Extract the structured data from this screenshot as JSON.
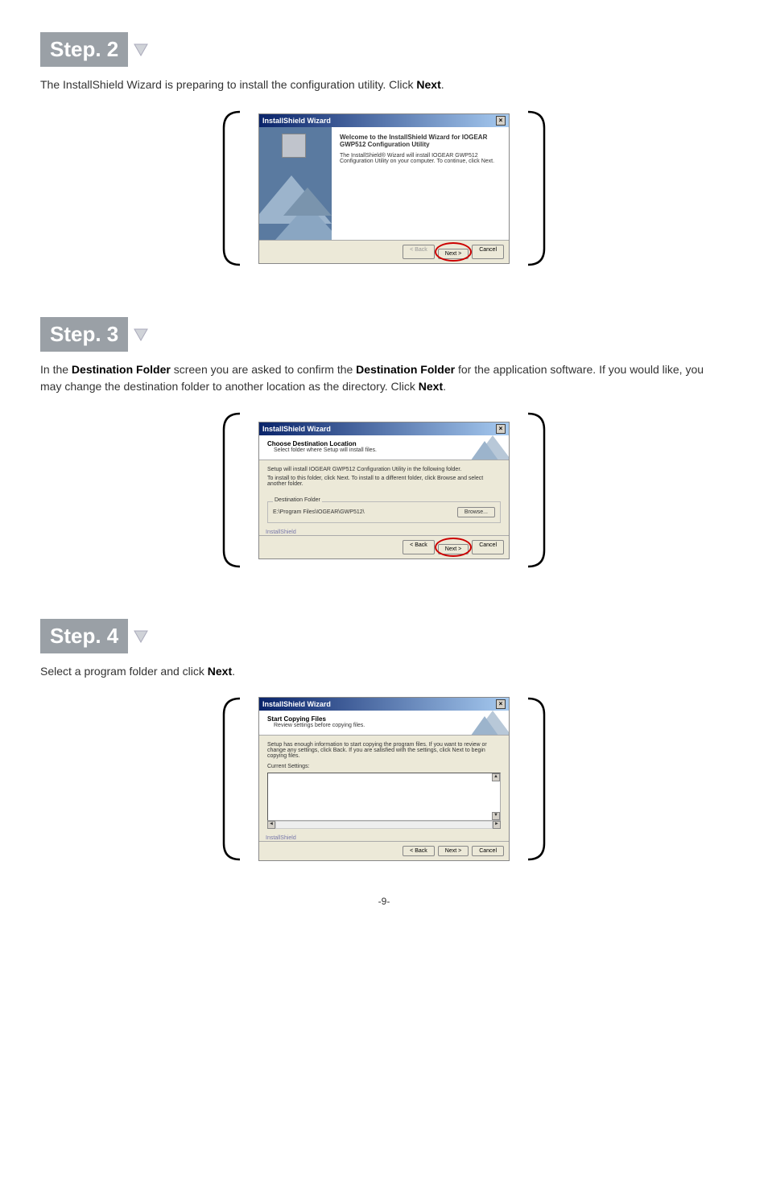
{
  "page_number": "-9-",
  "steps": {
    "s2": {
      "badge": "Step. 2",
      "desc_pre": "The InstallShield Wizard is preparing to install the configuration utility. Click ",
      "desc_bold": "Next",
      "desc_post": "."
    },
    "s3": {
      "badge": "Step. 3",
      "desc_p1": "In the ",
      "desc_b1": "Destination Folder",
      "desc_p2": " screen you are asked to confirm the ",
      "desc_b2": "Destination Folder",
      "desc_p3": " for the application software. If you would like, you may change the destination folder to another location as the directory. Click ",
      "desc_b3": "Next",
      "desc_p4": "."
    },
    "s4": {
      "badge": "Step. 4",
      "desc_pre": "Select a program folder and click ",
      "desc_bold": "Next",
      "desc_post": "."
    }
  },
  "dialog1": {
    "title": "InstallShield Wizard",
    "heading": "Welcome to the InstallShield Wizard for IOGEAR GWP512 Configuration Utility",
    "body": "The InstallShield® Wizard will install IOGEAR GWP512 Configuration Utility on your computer. To continue, click Next.",
    "btn_back": "< Back",
    "btn_next": "Next >",
    "btn_cancel": "Cancel"
  },
  "dialog2": {
    "title": "InstallShield Wizard",
    "heading": "Choose Destination Location",
    "sub": "Select folder where Setup will install files.",
    "line1": "Setup will install IOGEAR GWP512 Configuration Utility in the following folder.",
    "line2": "To install to this folder, click Next. To install to a different folder, click Browse and select another folder.",
    "group_label": "Destination Folder",
    "path": "E:\\Program Files\\IOGEAR\\GWP512\\",
    "btn_browse": "Browse...",
    "install_shield": "InstallShield",
    "btn_back": "< Back",
    "btn_next": "Next >",
    "btn_cancel": "Cancel"
  },
  "dialog3": {
    "title": "InstallShield Wizard",
    "heading": "Start Copying Files",
    "sub": "Review settings before copying files.",
    "line1": "Setup has enough information to start copying the program files. If you want to review or change any settings, click Back. If you are satisfied with the settings, click Next to begin copying files.",
    "current": "Current Settings:",
    "install_shield": "InstallShield",
    "btn_back": "< Back",
    "btn_next": "Next >",
    "btn_cancel": "Cancel"
  }
}
